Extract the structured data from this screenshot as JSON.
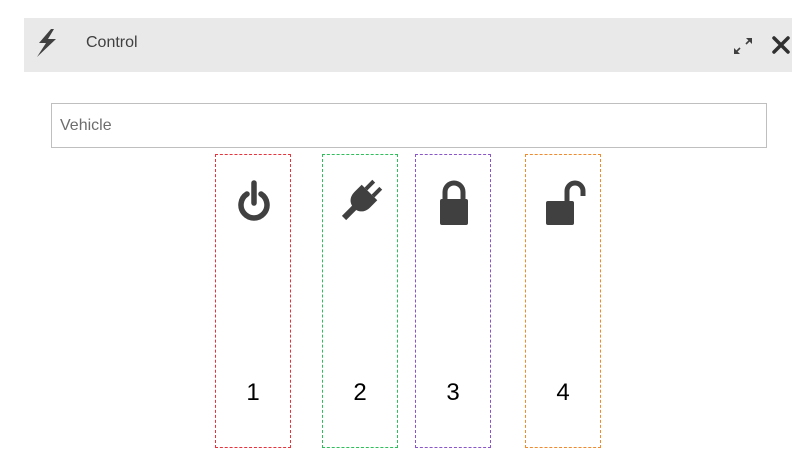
{
  "window": {
    "title": "Control",
    "icon": "lightning-bolt-icon",
    "actions": [
      "expand-icon",
      "close-icon"
    ]
  },
  "vehicle_field": {
    "placeholder": "Vehicle",
    "value": ""
  },
  "commands": [
    {
      "icon": "power-icon",
      "number": "1",
      "outline_color": "#e8323c"
    },
    {
      "icon": "plug-icon",
      "number": "2",
      "outline_color": "#2fbf5a"
    },
    {
      "icon": "lock-icon",
      "number": "3",
      "outline_color": "#8a55c8"
    },
    {
      "icon": "unlock-icon",
      "number": "4",
      "outline_color": "#f08a2c"
    }
  ],
  "colors": {
    "icon": "#404040",
    "header_bg": "#e9e9e9",
    "panel_bg": "#f0f0f0"
  }
}
